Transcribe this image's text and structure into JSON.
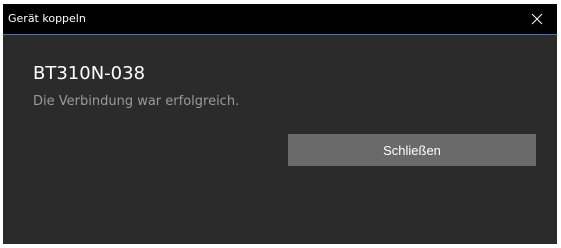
{
  "window": {
    "title": "Gerät koppeln"
  },
  "content": {
    "device_name": "BT310N-038",
    "status": "Die Verbindung war erfolgreich.",
    "close_button_label": "Schließen"
  },
  "icons": {
    "titlebar_close": "close-icon"
  },
  "colors": {
    "titlebar_bg": "#000000",
    "titlebar_accent_line": "#3e78b6",
    "dialog_bg": "#2b2b2b",
    "button_bg": "#6a6a6a",
    "status_text": "#9a9a9a"
  }
}
